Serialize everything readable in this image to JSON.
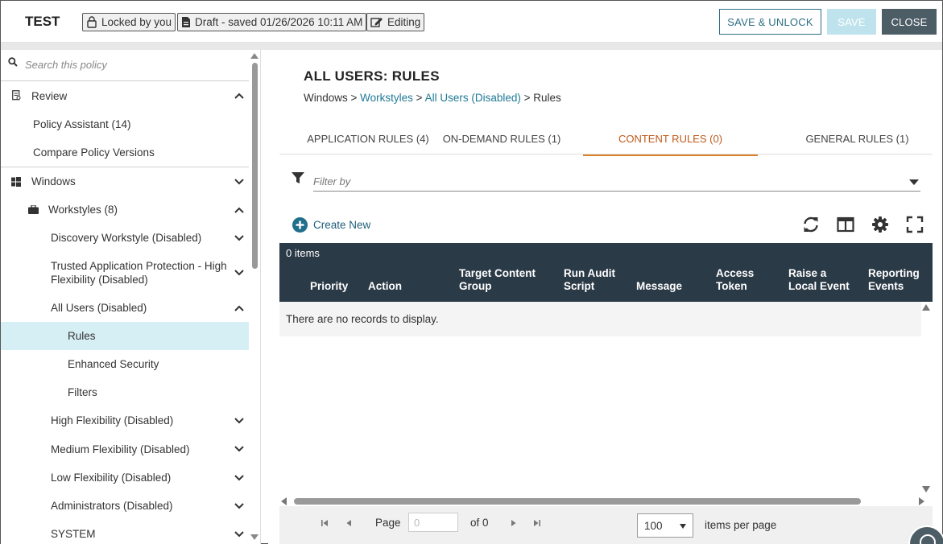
{
  "header": {
    "title": "TEST",
    "locked_label": "Locked by you",
    "draft_label": "Draft - saved 01/26/2026 10:11 AM",
    "editing_label": "Editing",
    "save_unlock_label": "SAVE & UNLOCK",
    "save_label": "SAVE",
    "close_label": "CLOSE"
  },
  "sidebar": {
    "search_placeholder": "Search this policy",
    "items": [
      {
        "label": "Review"
      },
      {
        "label": "Policy Assistant (14)"
      },
      {
        "label": "Compare Policy Versions"
      },
      {
        "label": "Windows"
      },
      {
        "label": "Workstyles (8)"
      },
      {
        "label": "Discovery Workstyle (Disabled)"
      },
      {
        "label": "Trusted Application Protection - High Flexibility (Disabled)"
      },
      {
        "label": "All Users (Disabled)"
      },
      {
        "label": "Rules"
      },
      {
        "label": "Enhanced Security"
      },
      {
        "label": "Filters"
      },
      {
        "label": "High Flexibility (Disabled)"
      },
      {
        "label": "Medium Flexibility (Disabled)"
      },
      {
        "label": "Low Flexibility (Disabled)"
      },
      {
        "label": "Administrators (Disabled)"
      },
      {
        "label": "SYSTEM"
      }
    ]
  },
  "main": {
    "title": "ALL USERS: RULES",
    "breadcrumb": {
      "root": "Windows",
      "sep": " > ",
      "link1": "Workstyles",
      "link2": "All Users (Disabled)",
      "current": "Rules"
    },
    "tabs": [
      {
        "label": "APPLICATION RULES (4)"
      },
      {
        "label": "ON-DEMAND RULES (1)"
      },
      {
        "label": "CONTENT RULES (0)"
      },
      {
        "label": "GENERAL RULES (1)"
      }
    ],
    "filter_placeholder": "Filter by",
    "create_new_label": "Create New",
    "grid": {
      "items_count": "0 items",
      "columns": [
        "Priority",
        "Action",
        "Target Content Group",
        "Run Audit Script",
        "Message",
        "Access Token",
        "Raise a Local Event",
        "Reporting Events"
      ],
      "empty_message": "There are no records to display."
    },
    "pager": {
      "page_label": "Page",
      "page_value": "0",
      "of_label": "of 0",
      "page_size": "100",
      "items_per_page_label": "items per page"
    }
  },
  "colors": {
    "accent": "#1f7a96",
    "active_tab": "#c05a1a",
    "grid_header": "#2b3a47",
    "selected_nav": "#d6eff5"
  }
}
